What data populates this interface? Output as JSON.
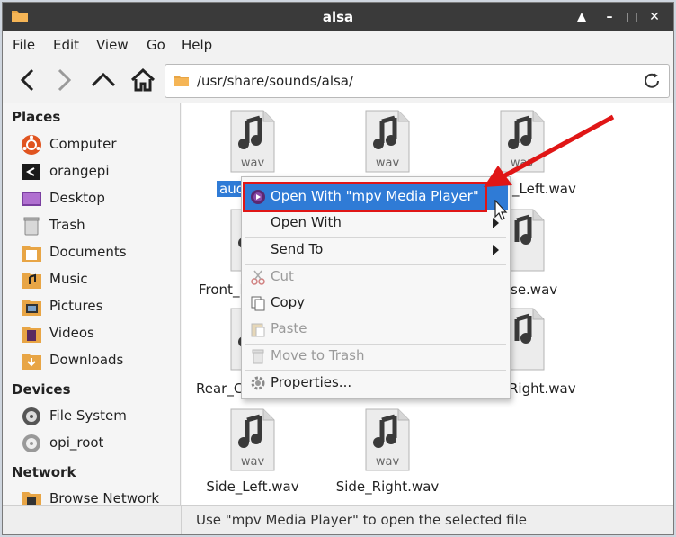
{
  "window": {
    "title": "alsa",
    "buttons": {
      "up": "▲",
      "minimize": "–",
      "maximize": "□",
      "close": "✕"
    }
  },
  "menubar": {
    "items": [
      "File",
      "Edit",
      "View",
      "Go",
      "Help"
    ]
  },
  "toolbar": {
    "path": "/usr/share/sounds/alsa/",
    "icons": [
      "back-icon",
      "forward-icon",
      "up-icon",
      "home-icon",
      "reload-icon"
    ]
  },
  "sidebar": {
    "places_title": "Places",
    "places": [
      "Computer",
      "orangepi",
      "Desktop",
      "Trash",
      "Documents",
      "Music",
      "Pictures",
      "Videos",
      "Downloads"
    ],
    "devices_title": "Devices",
    "devices": [
      "File System",
      "opi_root"
    ],
    "network_title": "Network",
    "network": [
      "Browse Network"
    ]
  },
  "files": {
    "icon_text": "wav",
    "names": [
      "aud",
      "",
      "_Left.wav",
      "Front_F",
      "se.wav",
      "Rear_C",
      "Right.wav",
      "Side_Left.wav",
      "Side_Right.wav"
    ]
  },
  "context_menu": {
    "items": [
      {
        "label": "Open With \"mpv Media Player\"",
        "state": "highlighted"
      },
      {
        "label": "Open With",
        "state": "normal"
      },
      {
        "label": "Send To",
        "state": "normal"
      },
      {
        "label": "Cut",
        "state": "disabled"
      },
      {
        "label": "Copy",
        "state": "normal"
      },
      {
        "label": "Paste",
        "state": "disabled"
      },
      {
        "label": "Move to Trash",
        "state": "disabled"
      },
      {
        "label": "Properties...",
        "state": "normal"
      }
    ]
  },
  "status": {
    "text": "Use \"mpv Media Player\" to open the selected file"
  },
  "colors": {
    "accent": "#2f7bd6",
    "annotation": "#e01616",
    "titlebar": "#3a3a3a"
  }
}
